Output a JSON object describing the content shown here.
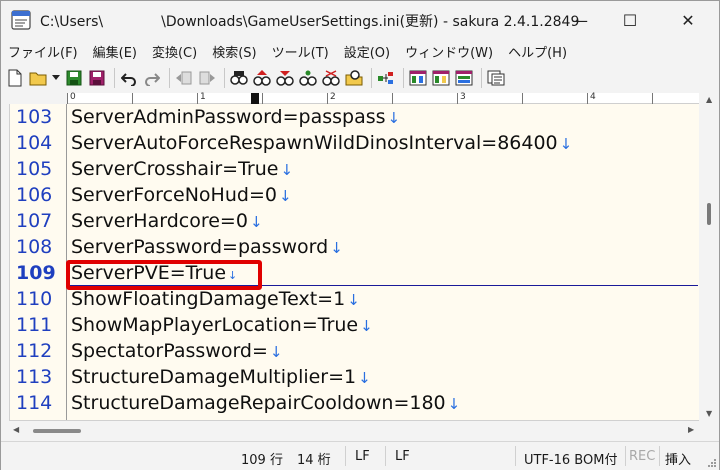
{
  "window": {
    "title_prefix": "C:\\Users\\",
    "title_suffix": "\\Downloads\\GameUserSettings.ini(更新) - sakura 2.4.1.2849",
    "minimize_label": "—",
    "maximize_label": "☐",
    "close_label": "✕"
  },
  "menu": [
    "ファイル(F)",
    "編集(E)",
    "変換(C)",
    "検索(S)",
    "ツール(T)",
    "設定(O)",
    "ウィンドウ(W)",
    "ヘルプ(H)"
  ],
  "ruler": {
    "marks": [
      "0",
      "1",
      "2",
      "3",
      "4"
    ]
  },
  "editor": {
    "eol_glyph": "↓",
    "lines": [
      {
        "num": "103",
        "text": "ServerAdminPassword=passpass"
      },
      {
        "num": "104",
        "text": "ServerAutoForceRespawnWildDinosInterval=86400"
      },
      {
        "num": "105",
        "text": "ServerCrosshair=True"
      },
      {
        "num": "106",
        "text": "ServerForceNoHud=0"
      },
      {
        "num": "107",
        "text": "ServerHardcore=0"
      },
      {
        "num": "108",
        "text": "ServerPassword=password"
      },
      {
        "num": "109",
        "text": "ServerPVE=True"
      },
      {
        "num": "110",
        "text": "ShowFloatingDamageText=1"
      },
      {
        "num": "111",
        "text": "ShowMapPlayerLocation=True"
      },
      {
        "num": "112",
        "text": "SpectatorPassword="
      },
      {
        "num": "113",
        "text": "StructureDamageMultiplier=1"
      },
      {
        "num": "114",
        "text": "StructureDamageRepairCooldown=180"
      }
    ],
    "current_line": "109",
    "highlight_color": "#e00000"
  },
  "status": {
    "line": "109 行",
    "column": "14 桁",
    "eol1": "LF",
    "eol2": "LF",
    "encoding": "UTF-16 BOM付",
    "rec": "REC",
    "mode": "挿入"
  },
  "colors": {
    "line_number": "#1f3fbf",
    "eol_mark": "#2a6fe0",
    "editor_bg": "#fffbf0"
  }
}
